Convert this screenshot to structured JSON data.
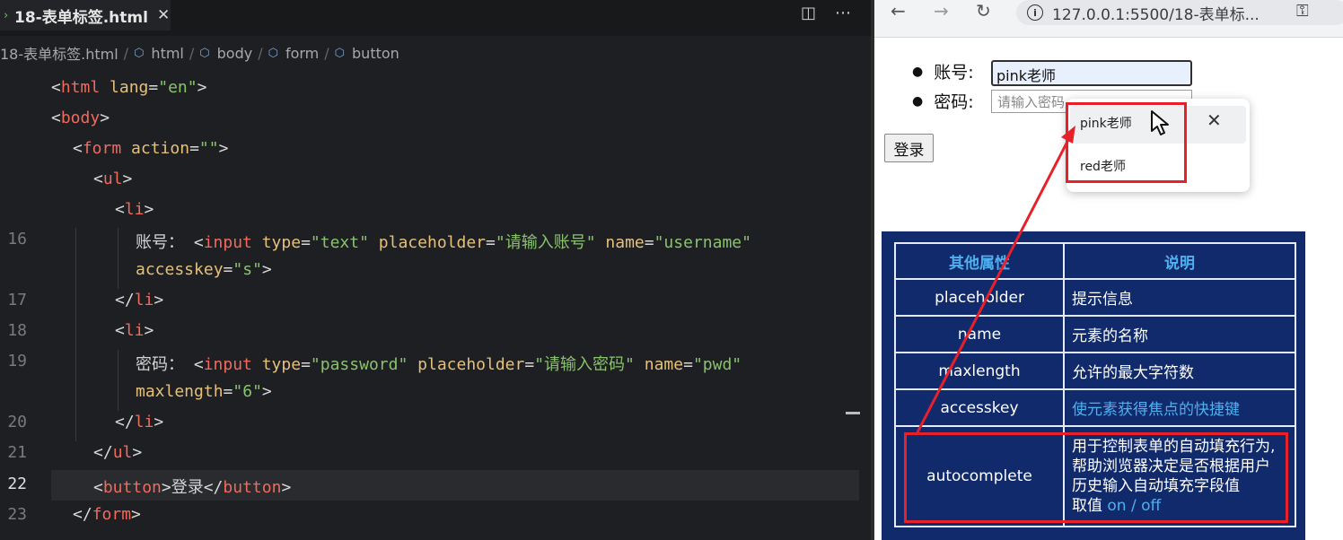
{
  "editor": {
    "tab": {
      "chevron": "›",
      "filename": "18-表单标签.html",
      "close": "✕"
    },
    "toolbar": {
      "split_icon": "◫",
      "more_icon": "⋯"
    },
    "breadcrumb": [
      "18-表单标签.html",
      "html",
      "body",
      "form",
      "button"
    ],
    "line_numbers": {
      "l16": "16",
      "l17": "17",
      "l18": "18",
      "l19": "19",
      "l20": "20",
      "l21": "21",
      "l22": "22",
      "l23": "23"
    },
    "code": {
      "html_tag": "html",
      "lang_attr": "lang",
      "lang_val": "\"en\"",
      "body_tag": "body",
      "form_tag": "form",
      "action_attr": "action",
      "action_val": "\"\"",
      "ul_tag": "ul",
      "li_tag": "li",
      "label_account": "账号：",
      "input_tag": "input",
      "type_attr": "type",
      "text_val": "\"text\"",
      "placeholder_attr": "placeholder",
      "ph_account": "\"请输入账号\"",
      "name_attr": "name",
      "username_val": "\"username\"",
      "accesskey_attr": "accesskey",
      "s_val": "\"s\"",
      "label_pwd": "密码：",
      "password_val": "\"password\"",
      "ph_pwd": "\"请输入密码\"",
      "pwd_val": "\"pwd\"",
      "maxlength_attr": "maxlength",
      "six_val": "\"6\"",
      "button_tag": "button",
      "button_text": "登录"
    }
  },
  "browser": {
    "nav": {
      "back": "←",
      "forward": "→",
      "reload": "↻"
    },
    "url": "127.0.0.1:5500/18-表单标...",
    "info_icon": "i",
    "key_icon": "⚿",
    "form": {
      "account_label": "账号:",
      "account_value": "pink老师",
      "password_label": "密码:",
      "password_placeholder": "请输入密码",
      "login_button": "登录"
    },
    "autocomplete": {
      "items": [
        "pink老师",
        "red老师"
      ],
      "close": "✕"
    },
    "table": {
      "headers": [
        "其他属性",
        "说明"
      ],
      "rows": [
        {
          "attr": "placeholder",
          "desc": "提示信息"
        },
        {
          "attr": "name",
          "desc": "元素的名称"
        },
        {
          "attr": "maxlength",
          "desc": "允许的最大字符数"
        },
        {
          "attr": "accesskey",
          "desc": "使元素获得焦点的快捷键"
        }
      ],
      "autocomplete_row": {
        "attr": "autocomplete",
        "desc_lines": [
          "用于控制表单的自动填充行为,",
          "帮助浏览器决定是否根据用户",
          "历史输入自动填充字段值"
        ],
        "value_prefix": "取值 ",
        "value_options": "on / off"
      }
    }
  },
  "colors": {
    "annotation_red": "#e8202a",
    "panel_blue": "#102a6b",
    "highlight_blue": "#4fb0f0"
  }
}
